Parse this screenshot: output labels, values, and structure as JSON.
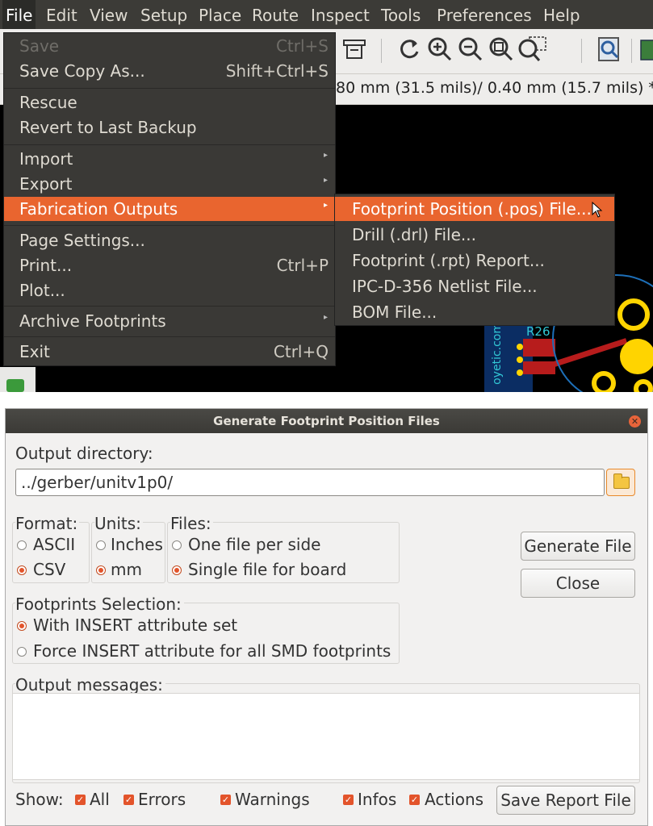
{
  "menubar": {
    "items": [
      "File",
      "Edit",
      "View",
      "Setup",
      "Place",
      "Route",
      "Inspect",
      "Tools",
      "Preferences",
      "Help"
    ]
  },
  "toolbar": {
    "status_text": "80 mm (31.5 mils)/ 0.40 mm (15.7 mils) *"
  },
  "file_menu": {
    "items": [
      {
        "label": "Save",
        "shortcut": "Ctrl+S",
        "disabled": true
      },
      {
        "label": "Save Copy As...",
        "shortcut": "Shift+Ctrl+S"
      },
      {
        "label": "Rescue"
      },
      {
        "label": "Revert to Last Backup"
      },
      {
        "label": "Import",
        "submenu": true
      },
      {
        "label": "Export",
        "submenu": true
      },
      {
        "label": "Fabrication Outputs",
        "submenu": true,
        "highlighted": true
      },
      {
        "label": "Page Settings..."
      },
      {
        "label": "Print...",
        "shortcut": "Ctrl+P"
      },
      {
        "label": "Plot..."
      },
      {
        "label": "Archive Footprints",
        "submenu": true
      },
      {
        "label": "Exit",
        "shortcut": "Ctrl+Q"
      }
    ]
  },
  "fabrication_submenu": {
    "items": [
      {
        "label": "Footprint Position (.pos) File...",
        "highlighted": true
      },
      {
        "label": "Drill (.drl) File..."
      },
      {
        "label": "Footprint (.rpt) Report..."
      },
      {
        "label": "IPC-D-356 Netlist File..."
      },
      {
        "label": "BOM File..."
      }
    ]
  },
  "pcb": {
    "silkscreen_label": "R26",
    "side_text": "oyetic.com"
  },
  "dialog": {
    "title": "Generate Footprint Position Files",
    "output_directory_label": "Output directory:",
    "output_directory_value": "../gerber/unitv1p0/",
    "format": {
      "label": "Format:",
      "options": [
        "ASCII",
        "CSV"
      ],
      "selected": "CSV"
    },
    "units": {
      "label": "Units:",
      "options": [
        "Inches",
        "mm"
      ],
      "selected": "mm"
    },
    "files": {
      "label": "Files:",
      "options": [
        "One file per side",
        "Single file for board"
      ],
      "selected": "Single file for board"
    },
    "footprints_selection": {
      "label": "Footprints Selection:",
      "options": [
        "With INSERT attribute set",
        "Force INSERT attribute for all SMD footprints"
      ],
      "selected": "With INSERT attribute set"
    },
    "generate_button": "Generate File",
    "close_button": "Close",
    "output_messages_label": "Output messages:",
    "show_label": "Show:",
    "filters": [
      {
        "label": "All",
        "checked": true
      },
      {
        "label": "Errors",
        "checked": true
      },
      {
        "label": "Warnings",
        "checked": true
      },
      {
        "label": "Infos",
        "checked": true
      },
      {
        "label": "Actions",
        "checked": true
      }
    ],
    "save_report_button": "Save Report File"
  },
  "colors": {
    "menu_highlight": "#e9652f",
    "menubar_bg": "#3c3b37",
    "dialog_bg": "#f2f1f0",
    "pcb_gold": "#ffd400"
  }
}
